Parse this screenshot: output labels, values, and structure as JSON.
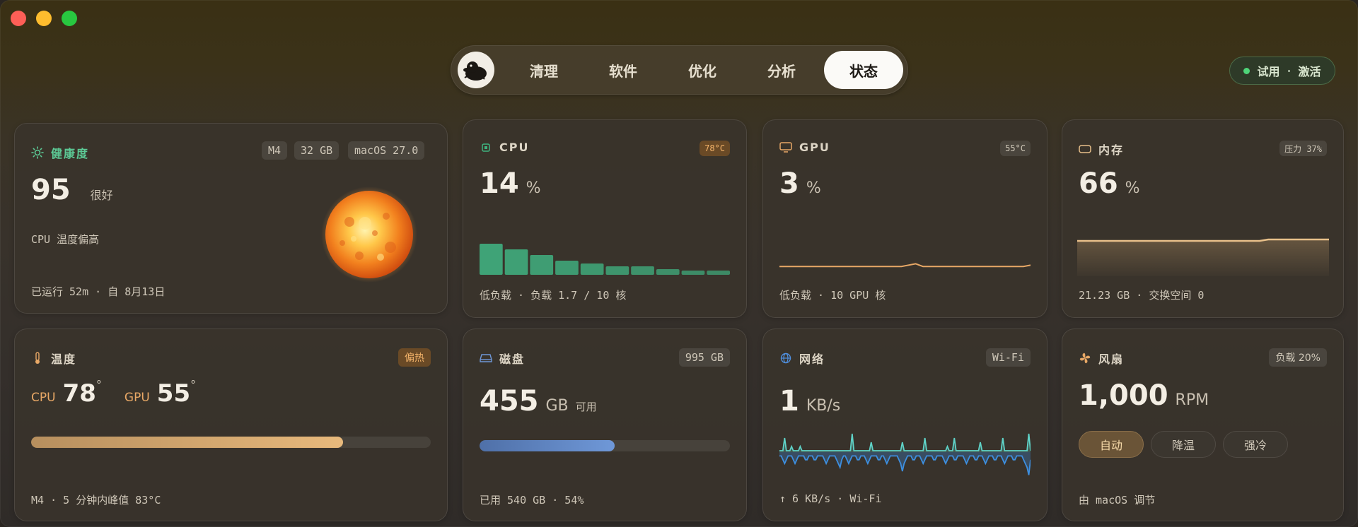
{
  "nav": {
    "tabs": [
      "清理",
      "软件",
      "优化",
      "分析",
      "状态"
    ],
    "active": "状态"
  },
  "trial": {
    "status": "试用",
    "sep": "·",
    "action": "激活"
  },
  "health": {
    "title": "健康度",
    "chips": [
      "M4",
      "32 GB",
      "macOS 27.0"
    ],
    "score": "95",
    "score_label": "很好",
    "note": "CPU 温度偏高",
    "footer": "已运行 52m · 自 8月13日",
    "icon": "sun-icon",
    "accent": "#4fc48a"
  },
  "cpu": {
    "title": "CPU",
    "temp_badge": "78°C",
    "value": "14",
    "unit": "%",
    "footer": "低负载 · 负载 1.7 / 10 核",
    "chart_data": {
      "type": "bar",
      "values": [
        22,
        18,
        14,
        10,
        8,
        6,
        6,
        4,
        3,
        3
      ],
      "color": "#3fa377"
    }
  },
  "gpu": {
    "title": "GPU",
    "temp_badge": "55°C",
    "value": "3",
    "unit": "%",
    "footer": "低负载 · 10 GPU 核",
    "chart_data": {
      "type": "line",
      "values": [
        3,
        3,
        3,
        3,
        3,
        3,
        3,
        3,
        3,
        3,
        3,
        3,
        3,
        3,
        3,
        3,
        3,
        3,
        4,
        5,
        3,
        3,
        3,
        3,
        3,
        3,
        3,
        3,
        3,
        3,
        3,
        3,
        3,
        3,
        3,
        4
      ],
      "color": "#e8a866"
    }
  },
  "memory": {
    "title": "内存",
    "pressure_badge": "压力 37%",
    "value": "66",
    "unit": "%",
    "footer": "21.23 GB · 交换空间 0",
    "chart_data": {
      "type": "area",
      "values": [
        66,
        66,
        66,
        66,
        66,
        66,
        66,
        66,
        66,
        66,
        66,
        66,
        66,
        66,
        66,
        66,
        66,
        66,
        66,
        66,
        66,
        66,
        67,
        67,
        67,
        67,
        67,
        67,
        67,
        67
      ],
      "color": "#e8c08a"
    }
  },
  "temperature": {
    "title": "温度",
    "badge": "偏热",
    "cpu_label": "CPU",
    "cpu_value": "78",
    "gpu_label": "GPU",
    "gpu_value": "55",
    "degree": "°",
    "bar_fraction": 0.78,
    "footer": "M4 · 5 分钟内峰值 83°C"
  },
  "disk": {
    "title": "磁盘",
    "badge": "995 GB",
    "value": "455",
    "unit": "GB",
    "unit_note": "可用",
    "bar_fraction": 0.54,
    "footer": "已用 540 GB · 54%"
  },
  "network": {
    "title": "网络",
    "badge": "Wi-Fi",
    "value": "1",
    "unit": "KB/s",
    "footer": "↑ 6 KB/s · Wi-Fi",
    "chart_data": {
      "type": "line",
      "download": [
        0,
        0,
        0,
        3,
        0,
        0,
        0,
        1,
        0,
        0,
        0,
        0,
        1,
        0,
        0,
        0,
        0,
        0,
        0,
        0,
        0,
        0,
        0,
        0,
        0,
        0,
        0,
        0,
        0,
        0,
        0,
        0,
        0,
        0,
        0,
        0,
        0,
        0,
        0,
        0,
        0,
        0,
        4,
        0,
        0,
        0,
        0,
        0,
        0,
        0,
        0,
        0,
        0,
        2,
        0,
        0,
        0,
        0,
        0,
        0,
        0,
        0,
        0,
        0,
        0,
        0,
        0,
        0,
        0,
        0,
        0,
        2,
        0,
        0,
        0,
        0,
        0,
        0,
        0,
        0,
        0,
        0,
        0,
        0,
        3,
        0,
        0,
        0,
        0,
        0,
        0,
        0,
        0,
        0,
        0,
        0,
        0,
        1,
        0,
        0,
        0,
        3,
        0,
        0,
        0,
        0,
        0,
        0,
        0,
        0,
        0,
        0,
        0,
        0,
        0,
        0,
        2,
        0,
        0,
        0,
        0,
        0,
        0,
        0,
        0,
        0,
        0,
        0,
        0,
        3,
        0,
        0,
        0,
        0,
        0,
        0,
        0,
        0,
        0,
        0,
        0,
        0,
        0,
        0,
        4,
        0
      ],
      "upload": [
        1,
        1,
        2,
        3,
        2,
        1,
        1,
        1,
        2,
        3,
        2,
        1,
        1,
        1,
        1,
        2,
        2,
        1,
        1,
        1,
        2,
        2,
        1,
        1,
        1,
        1,
        2,
        3,
        2,
        1,
        1,
        1,
        1,
        2,
        3,
        4,
        2,
        1,
        1,
        2,
        3,
        2,
        1,
        1,
        1,
        2,
        2,
        1,
        1,
        1,
        2,
        3,
        2,
        1,
        1,
        1,
        1,
        2,
        2,
        1,
        1,
        2,
        3,
        2,
        1,
        1,
        1,
        1,
        1,
        2,
        3,
        5,
        3,
        2,
        1,
        1,
        1,
        2,
        2,
        1,
        1,
        1,
        2,
        3,
        2,
        1,
        1,
        1,
        1,
        2,
        2,
        1,
        1,
        1,
        1,
        2,
        3,
        2,
        1,
        1,
        1,
        2,
        2,
        1,
        1,
        1,
        1,
        2,
        3,
        2,
        1,
        1,
        1,
        2,
        2,
        1,
        1,
        1,
        2,
        3,
        2,
        1,
        1,
        1,
        2,
        2,
        1,
        1,
        1,
        2,
        3,
        2,
        1,
        1,
        1,
        2,
        2,
        1,
        1,
        1,
        1,
        2,
        3,
        4,
        6,
        2
      ],
      "download_color": "#5fd3c8",
      "upload_color": "#3d8fe0"
    }
  },
  "fan": {
    "title": "风扇",
    "badge": "负载 20%",
    "value": "1,000",
    "unit": "RPM",
    "modes": [
      "自动",
      "降温",
      "强冷"
    ],
    "active_mode": "自动",
    "footer": "由 macOS 调节"
  }
}
